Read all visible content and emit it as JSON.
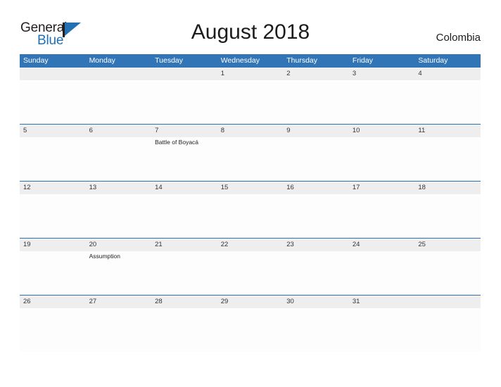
{
  "brand": {
    "word_one": "General",
    "word_two": "Blue",
    "flag_icon": "blue-triangle-flag-icon",
    "accent_color": "#2470b3"
  },
  "header": {
    "title": "August 2018",
    "country": "Colombia"
  },
  "theme": {
    "header_blue": "#3275b6",
    "row_divider_blue": "#2e6fad",
    "number_band_gray": "#eeeeee",
    "page_background": "#ffffff"
  },
  "calendar": {
    "month": "August",
    "year": "2018",
    "day_headers": [
      "Sunday",
      "Monday",
      "Tuesday",
      "Wednesday",
      "Thursday",
      "Friday",
      "Saturday"
    ],
    "weeks": [
      {
        "days": [
          {
            "num": "",
            "events": []
          },
          {
            "num": "",
            "events": []
          },
          {
            "num": "",
            "events": []
          },
          {
            "num": "1",
            "events": []
          },
          {
            "num": "2",
            "events": []
          },
          {
            "num": "3",
            "events": []
          },
          {
            "num": "4",
            "events": []
          }
        ]
      },
      {
        "days": [
          {
            "num": "5",
            "events": []
          },
          {
            "num": "6",
            "events": []
          },
          {
            "num": "7",
            "events": [
              "Battle of Boyacá"
            ]
          },
          {
            "num": "8",
            "events": []
          },
          {
            "num": "9",
            "events": []
          },
          {
            "num": "10",
            "events": []
          },
          {
            "num": "11",
            "events": []
          }
        ]
      },
      {
        "days": [
          {
            "num": "12",
            "events": []
          },
          {
            "num": "13",
            "events": []
          },
          {
            "num": "14",
            "events": []
          },
          {
            "num": "15",
            "events": []
          },
          {
            "num": "16",
            "events": []
          },
          {
            "num": "17",
            "events": []
          },
          {
            "num": "18",
            "events": []
          }
        ]
      },
      {
        "days": [
          {
            "num": "19",
            "events": []
          },
          {
            "num": "20",
            "events": [
              "Assumption"
            ]
          },
          {
            "num": "21",
            "events": []
          },
          {
            "num": "22",
            "events": []
          },
          {
            "num": "23",
            "events": []
          },
          {
            "num": "24",
            "events": []
          },
          {
            "num": "25",
            "events": []
          }
        ]
      },
      {
        "days": [
          {
            "num": "26",
            "events": []
          },
          {
            "num": "27",
            "events": []
          },
          {
            "num": "28",
            "events": []
          },
          {
            "num": "29",
            "events": []
          },
          {
            "num": "30",
            "events": []
          },
          {
            "num": "31",
            "events": []
          },
          {
            "num": "",
            "events": []
          }
        ]
      }
    ]
  }
}
